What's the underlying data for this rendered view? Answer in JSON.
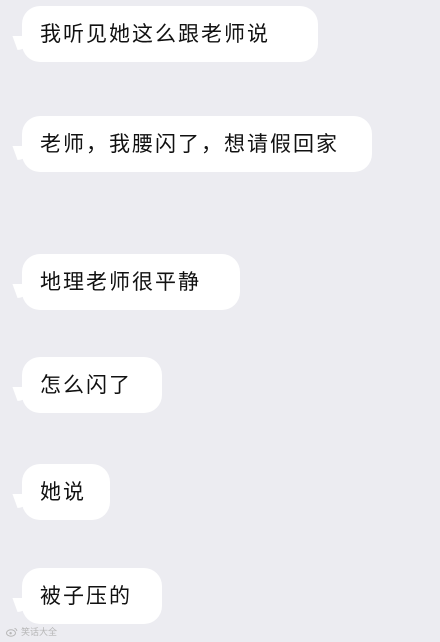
{
  "messages": [
    {
      "text": "我听见她这么跟老师说"
    },
    {
      "text": "老师，我腰闪了，想请假回家"
    },
    {
      "text": "地理老师很平静"
    },
    {
      "text": "怎么闪了"
    },
    {
      "text": "她说"
    },
    {
      "text": "被子压的"
    }
  ],
  "watermark": {
    "text": "笑话大全",
    "icon": "weibo-logo-icon"
  }
}
